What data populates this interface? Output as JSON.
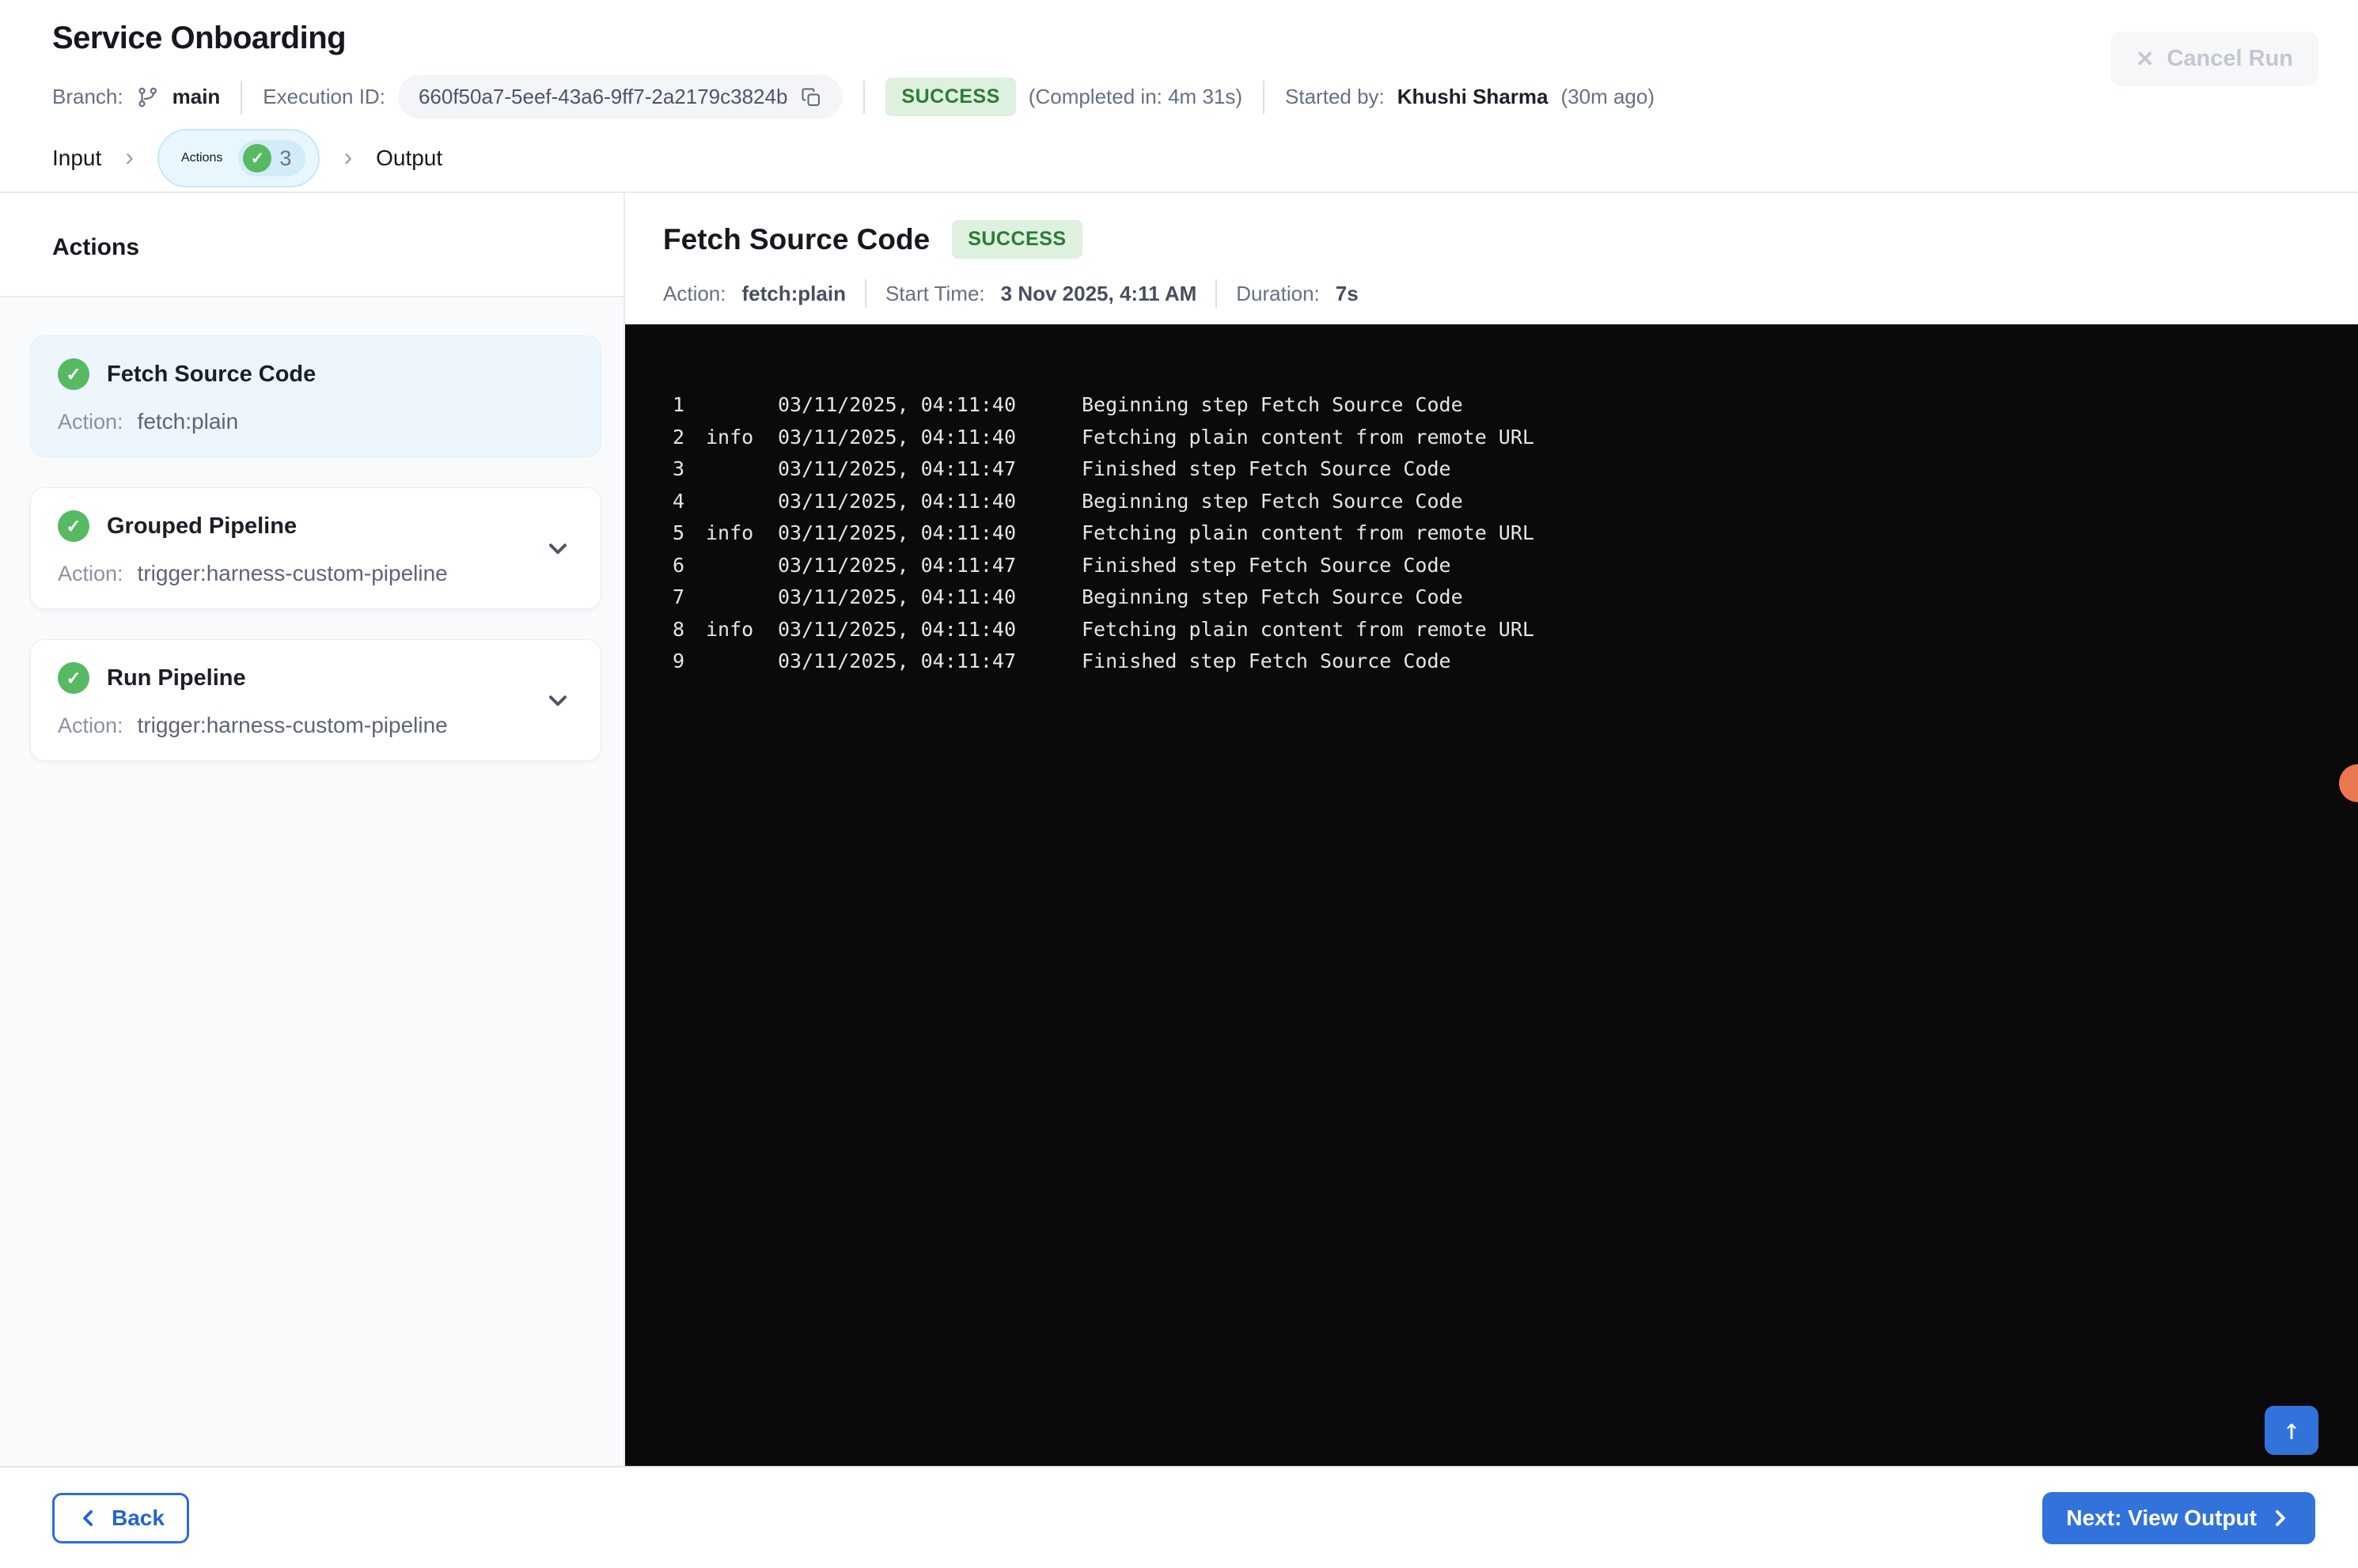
{
  "header": {
    "title": "Service Onboarding",
    "branch_label": "Branch:",
    "branch": "main",
    "execution_id_label": "Execution ID:",
    "execution_id": "660f50a7-5eef-43a6-9ff7-2a2179c3824b",
    "status": "SUCCESS",
    "completed_in": "(Completed in: 4m 31s)",
    "started_by_label": "Started by:",
    "started_by": "Khushi Sharma",
    "started_ago": "(30m ago)",
    "cancel_button": "Cancel Run"
  },
  "tabs": [
    {
      "label": "Input",
      "active": false
    },
    {
      "label": "Actions",
      "active": true,
      "count": "3"
    },
    {
      "label": "Output",
      "active": false
    }
  ],
  "sidebar": {
    "heading": "Actions",
    "items": [
      {
        "title": "Fetch Source Code",
        "action_label": "Action:",
        "action": "fetch:plain",
        "selected": true,
        "expandable": false
      },
      {
        "title": "Grouped Pipeline",
        "action_label": "Action:",
        "action": "trigger:harness-custom-pipeline",
        "selected": false,
        "expandable": true
      },
      {
        "title": "Run Pipeline",
        "action_label": "Action:",
        "action": "trigger:harness-custom-pipeline",
        "selected": false,
        "expandable": true
      }
    ]
  },
  "detail": {
    "title": "Fetch Source Code",
    "status": "SUCCESS",
    "action_label": "Action:",
    "action": "fetch:plain",
    "start_label": "Start Time:",
    "start": "3 Nov 2025, 4:11 AM",
    "duration_label": "Duration:",
    "duration": "7s"
  },
  "log": {
    "lines": [
      {
        "n": "1",
        "level": "",
        "ts": "03/11/2025, 04:11:40",
        "msg": "Beginning step Fetch Source Code"
      },
      {
        "n": "2",
        "level": "info",
        "ts": "03/11/2025, 04:11:40",
        "msg": "Fetching plain content from remote URL"
      },
      {
        "n": "3",
        "level": "",
        "ts": "03/11/2025, 04:11:47",
        "msg": "Finished step Fetch Source Code"
      },
      {
        "n": "4",
        "level": "",
        "ts": "03/11/2025, 04:11:40",
        "msg": "Beginning step Fetch Source Code"
      },
      {
        "n": "5",
        "level": "info",
        "ts": "03/11/2025, 04:11:40",
        "msg": "Fetching plain content from remote URL"
      },
      {
        "n": "6",
        "level": "",
        "ts": "03/11/2025, 04:11:47",
        "msg": "Finished step Fetch Source Code"
      },
      {
        "n": "7",
        "level": "",
        "ts": "03/11/2025, 04:11:40",
        "msg": "Beginning step Fetch Source Code"
      },
      {
        "n": "8",
        "level": "info",
        "ts": "03/11/2025, 04:11:40",
        "msg": "Fetching plain content from remote URL"
      },
      {
        "n": "9",
        "level": "",
        "ts": "03/11/2025, 04:11:47",
        "msg": "Finished step Fetch Source Code"
      }
    ]
  },
  "footer": {
    "back_button": "Back",
    "next_button": "Next: View Output"
  },
  "icons": {
    "close": "✕",
    "check": "✓",
    "arrow_up": "↑",
    "chevron_sep": "›"
  },
  "colors": {
    "accent_blue": "#3273db",
    "success_green": "#57b961",
    "success_badge_bg": "#def0de",
    "success_badge_text": "#2b7c36",
    "console_bg": "#0a0a0b",
    "console_text": "#e5e5e5",
    "active_tab_bg": "#e8f7fe",
    "active_tab_border": "#c5e9f7",
    "selected_card_bg": "#edf6fc",
    "sidebar_bg": "#f8fafc",
    "floating_dot": "#e9774f"
  }
}
